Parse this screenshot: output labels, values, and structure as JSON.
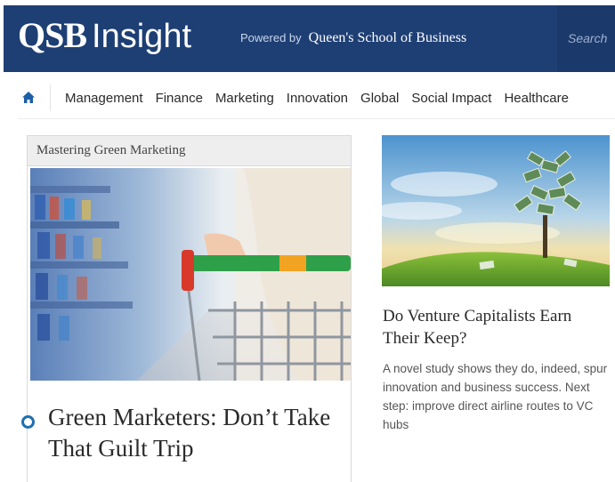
{
  "header": {
    "logo_qsb": "QSB",
    "logo_insight": "Insight",
    "powered_by": "Powered by",
    "school_name": "Queen's School of Business",
    "search_placeholder": "Search",
    "brand_color": "#1e3f74"
  },
  "nav": {
    "home_icon": "home-icon",
    "items": [
      {
        "label": "Management"
      },
      {
        "label": "Finance"
      },
      {
        "label": "Marketing"
      },
      {
        "label": "Innovation"
      },
      {
        "label": "Global"
      },
      {
        "label": "Social Impact"
      },
      {
        "label": "Healthcare"
      }
    ]
  },
  "featured": {
    "series": "Mastering Green Marketing",
    "headline": "Green Marketers: Don’t Take That Guilt Trip",
    "image": "shopping-cart-in-supermarket-aisle"
  },
  "secondary": {
    "headline": "Do Venture Capitalists Earn Their Keep?",
    "summary": "A novel study shows they do, indeed, spur innovation and business success. Next step: improve direct airline routes to VC hubs",
    "image": "money-tree-on-grassy-hill"
  }
}
